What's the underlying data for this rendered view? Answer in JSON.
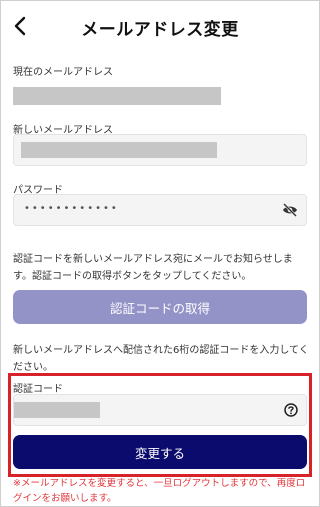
{
  "header": {
    "title": "メールアドレス変更",
    "back_icon": "chevron-left-icon"
  },
  "current_email": {
    "label": "現在のメールアドレス"
  },
  "new_email": {
    "label": "新しいメールアドレス"
  },
  "password": {
    "label": "パスワード",
    "value": "••••••••••••",
    "toggle_icon": "eye-off-icon"
  },
  "instructions": {
    "send_code": "認証コードを新しいメールアドレス宛にメールでお知らせします。認証コードの取得ボタンをタップしてください。",
    "enter_code": "新しいメールアドレスへ配信された6桁の認証コードを入力してください。"
  },
  "get_code_button": {
    "label": "認証コードの取得",
    "color": "#9493c8"
  },
  "auth_code": {
    "label": "認証コード",
    "help_icon": "question-circle-icon"
  },
  "submit_button": {
    "label": "変更する",
    "color": "#0b0b6e"
  },
  "note": {
    "text": "※メールアドレスを変更すると、一旦ログアウトしますので、再度ログインをお願いします。",
    "color": "#e2373d"
  },
  "highlight_color": "#d7222a"
}
